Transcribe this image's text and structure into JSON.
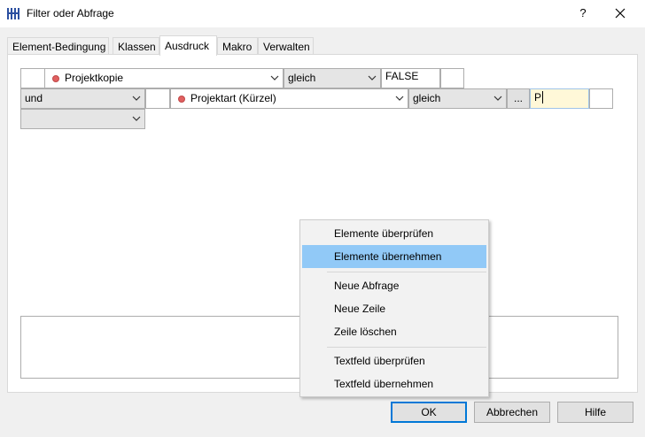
{
  "window": {
    "title": "Filter oder Abfrage",
    "help_label": "?"
  },
  "tabs": [
    {
      "label": "Element-Bedingung"
    },
    {
      "label": "Klassen"
    },
    {
      "label": "Ausdruck"
    },
    {
      "label": "Makro"
    },
    {
      "label": "Verwalten"
    }
  ],
  "active_tab": "Ausdruck",
  "rows": {
    "row1": {
      "lead": "",
      "attribute": "Projektkopie",
      "operator": "gleich",
      "value": "FALSE",
      "trail": ""
    },
    "row2": {
      "connector": "und",
      "lead": "",
      "attribute": "Projektart (Kürzel)",
      "operator": "gleich",
      "ellipsis": "...",
      "value": "P",
      "trail": ""
    },
    "row3": {
      "connector": ""
    }
  },
  "context_menu": {
    "items": [
      {
        "label": "Elemente überprüfen"
      },
      {
        "label": "Elemente übernehmen"
      },
      {
        "label": "Neue Abfrage"
      },
      {
        "label": "Neue Zeile"
      },
      {
        "label": "Zeile löschen"
      },
      {
        "label": "Textfeld überprüfen"
      },
      {
        "label": "Textfeld übernehmen"
      }
    ],
    "highlighted": "Elemente übernehmen"
  },
  "buttons": {
    "ok": "OK",
    "cancel": "Abbrechen",
    "help": "Hilfe"
  },
  "colors": {
    "accent": "#0078d7",
    "menu_highlight": "#91c9f7",
    "attribute_dot": "#e06060",
    "editing_bg": "#fff8d8"
  }
}
